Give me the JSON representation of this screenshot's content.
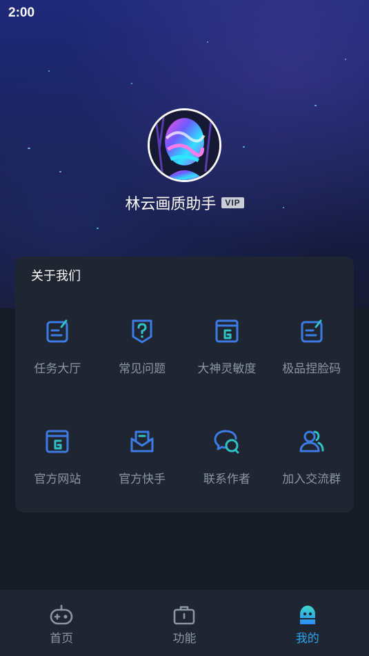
{
  "status_bar": {
    "time": "2:00"
  },
  "profile": {
    "name": "林云画质助手",
    "badge": "VIP"
  },
  "about_card": {
    "title": "关于我们",
    "items": [
      {
        "label": "任务大厅",
        "icon": "task-edit-icon"
      },
      {
        "label": "常见问题",
        "icon": "question-shield-icon"
      },
      {
        "label": "大神灵敏度",
        "icon": "g-window-icon"
      },
      {
        "label": "极品捏脸码",
        "icon": "face-code-edit-icon"
      },
      {
        "label": "官方网站",
        "icon": "website-g-icon"
      },
      {
        "label": "官方快手",
        "icon": "mail-icon"
      },
      {
        "label": "联系作者",
        "icon": "chat-bubbles-icon"
      },
      {
        "label": "加入交流群",
        "icon": "group-users-icon"
      }
    ]
  },
  "bottom_nav": {
    "items": [
      {
        "label": "首页",
        "icon": "gamepad-icon"
      },
      {
        "label": "功能",
        "icon": "toolbox-icon"
      },
      {
        "label": "我的",
        "icon": "ghost-mascot-icon",
        "active": true
      }
    ]
  },
  "colors": {
    "accent": "#2aa5f0",
    "icon_blue": "#3d7ce6",
    "icon_teal": "#2fc3c6",
    "card": "#1f2632",
    "page": "#161b24"
  }
}
